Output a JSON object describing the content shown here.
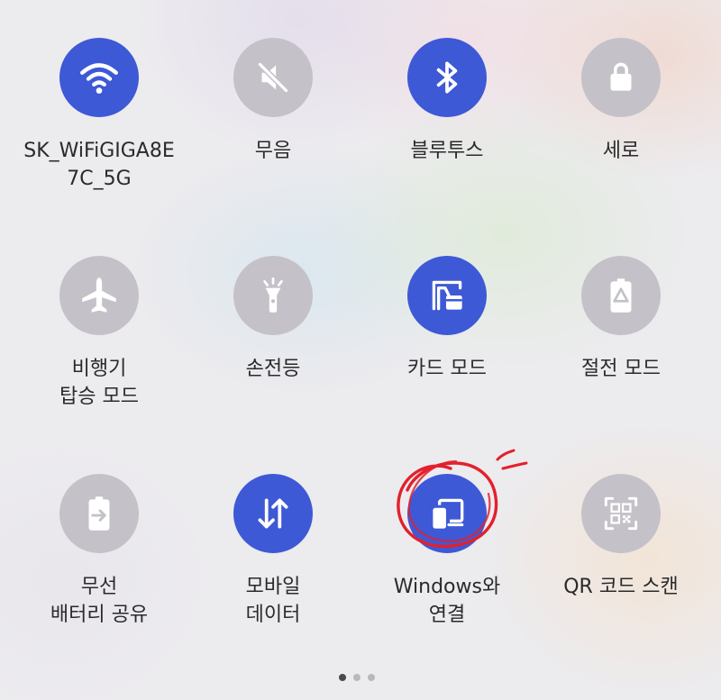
{
  "colors": {
    "active_tile": "#3d59d6",
    "inactive_tile": "#c4c2c8",
    "label_text": "#2a2a2c",
    "annotation": "#e3202c"
  },
  "tiles": [
    {
      "label": "SK_WiFiGIGA8E\n7C_5G",
      "icon": "wifi-icon",
      "state": "on"
    },
    {
      "label": "무음",
      "icon": "mute-icon",
      "state": "off"
    },
    {
      "label": "블루투스",
      "icon": "bluetooth-icon",
      "state": "on"
    },
    {
      "label": "세로",
      "icon": "portrait-lock-icon",
      "state": "off"
    },
    {
      "label": "비행기\n탑승 모드",
      "icon": "airplane-icon",
      "state": "off"
    },
    {
      "label": "손전등",
      "icon": "flashlight-icon",
      "state": "off"
    },
    {
      "label": "카드 모드",
      "icon": "card-mode-icon",
      "state": "on"
    },
    {
      "label": "절전 모드",
      "icon": "power-saving-icon",
      "state": "off"
    },
    {
      "label": "무선\n배터리 공유",
      "icon": "wireless-battery-share-icon",
      "state": "off"
    },
    {
      "label": "모바일\n데이터",
      "icon": "mobile-data-icon",
      "state": "on"
    },
    {
      "label": "Windows와\n연결",
      "icon": "link-to-windows-icon",
      "state": "on"
    },
    {
      "label": "QR 코드 스캔",
      "icon": "qr-scan-icon",
      "state": "off"
    }
  ],
  "pagination": {
    "pages": 3,
    "current_page": 1
  }
}
